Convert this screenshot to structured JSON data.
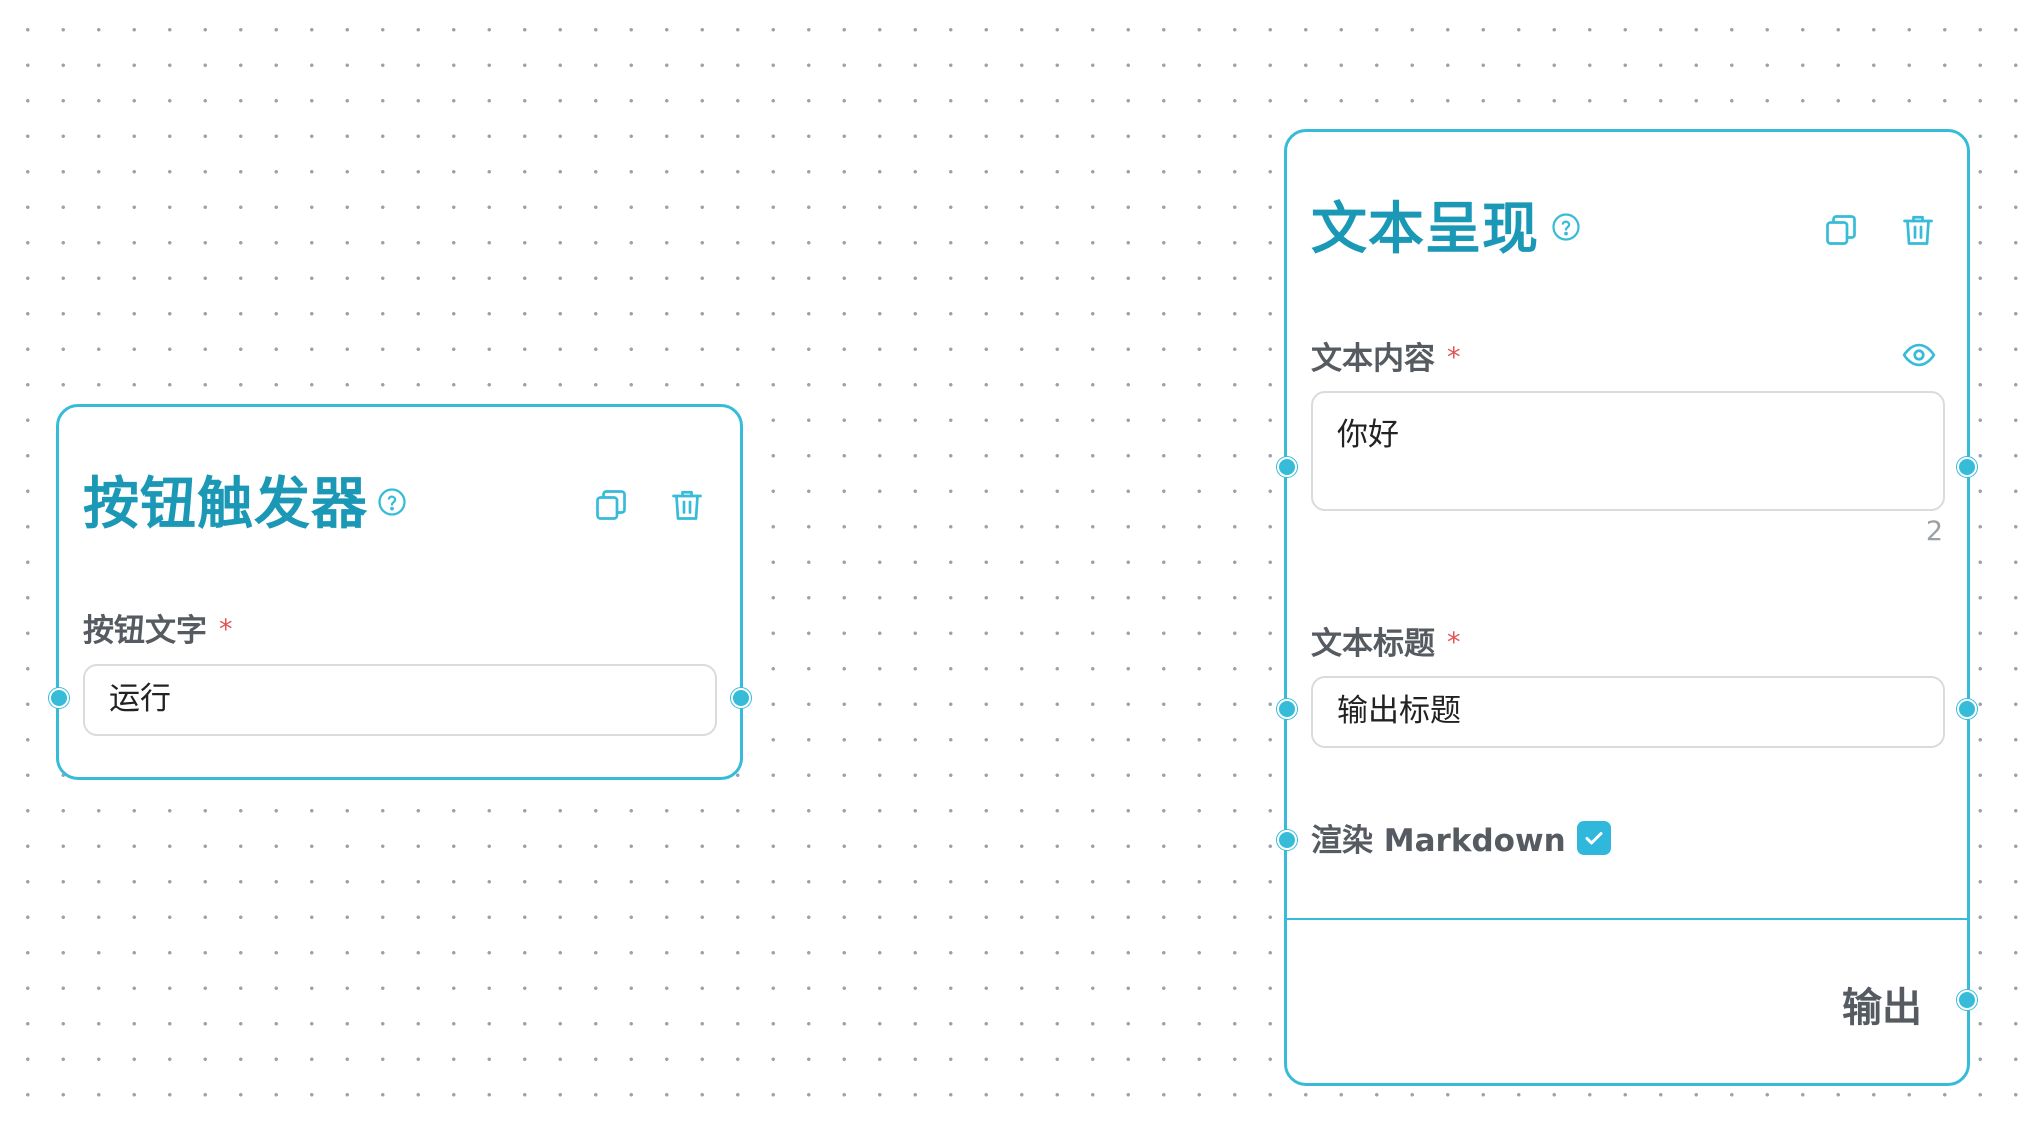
{
  "button_trigger_node": {
    "title": "按钮触发器",
    "field": {
      "label": "按钮文字",
      "required_mark": "*",
      "value": "运行"
    },
    "icons": {
      "help": "question-circle-icon",
      "copy": "copy-icon",
      "delete": "trash-icon"
    }
  },
  "text_display_node": {
    "title": "文本呈现",
    "content_field": {
      "label": "文本内容",
      "required_mark": "*",
      "value": "你好",
      "char_count": "2"
    },
    "title_field": {
      "label": "文本标题",
      "required_mark": "*",
      "value": "输出标题"
    },
    "markdown_field": {
      "label": "渲染 Markdown",
      "required_mark": "*",
      "checked": true
    },
    "output_label": "输出",
    "icons": {
      "help": "question-circle-icon",
      "copy": "copy-icon",
      "delete": "trash-icon",
      "preview": "eye-icon"
    }
  },
  "colors": {
    "accent": "#36bcd8",
    "title": "#1a98b5",
    "label": "#555b61",
    "required": "#e25555"
  }
}
